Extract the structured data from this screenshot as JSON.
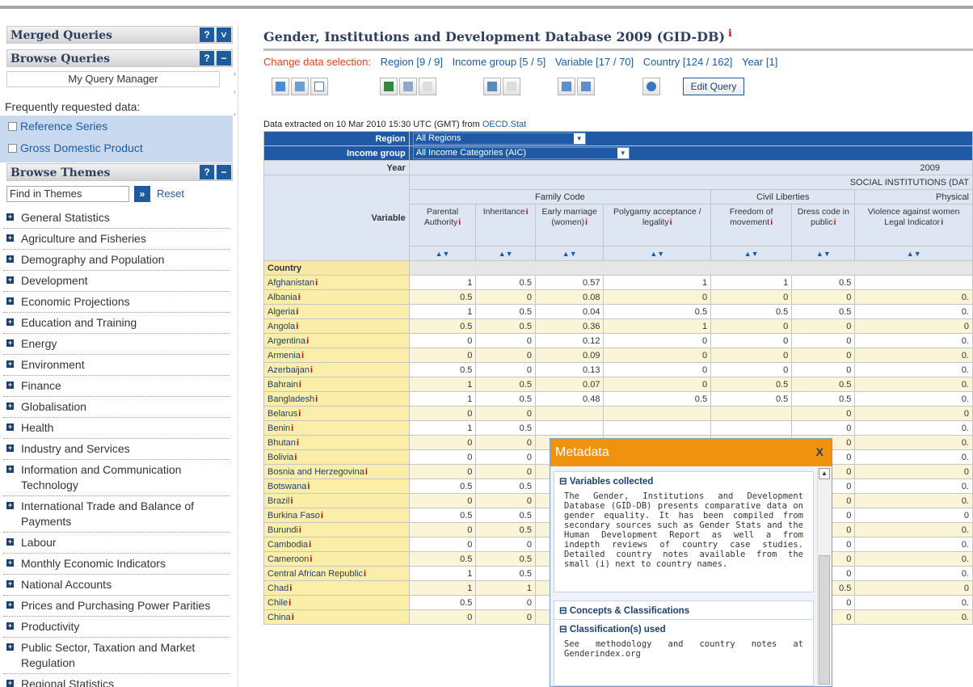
{
  "sidebar": {
    "merged_queries": "Merged Queries",
    "browse_queries": "Browse Queries",
    "help": "?",
    "expand": "˅",
    "collapse": "−",
    "my_query_manager": "My Query Manager",
    "frequently_requested": "Frequently requested data:",
    "freq_items": [
      "Reference Series",
      "Gross Domestic Product"
    ],
    "browse_themes": "Browse Themes",
    "find_placeholder": "Find in Themes",
    "find_go": "»",
    "reset": "Reset",
    "themes": [
      "General Statistics",
      "Agriculture and Fisheries",
      "Demography and Population",
      "Development",
      "Economic Projections",
      "Education and Training",
      "Energy",
      "Environment",
      "Finance",
      "Globalisation",
      "Health",
      "Industry and Services",
      "Information and Communication Technology",
      "International Trade and Balance of Payments",
      "Labour",
      "Monthly Economic Indicators",
      "National Accounts",
      "Prices and Purchasing Power Parities",
      "Productivity",
      "Public Sector, Taxation and Market Regulation",
      "Regional Statistics"
    ]
  },
  "main": {
    "title": "Gender, Institutions and Development Database 2009 (GID-DB)",
    "title_info": "i",
    "change_label": "Change data selection:",
    "selection_links": [
      "Region [9 / 9]",
      "Income group [5 / 5]",
      "Variable [17 / 70]",
      "Country [124 / 162]",
      "Year [1]"
    ],
    "edit_query": "Edit Query",
    "extracted_prefix": "Data extracted on 10 Mar 2010 15:30 UTC (GMT) from ",
    "extracted_source": "OECD.Stat"
  },
  "table": {
    "region_label": "Region",
    "region_value": "All Regions",
    "income_label": "Income group",
    "income_value": "All Income Categories (AIC)",
    "year_label": "Year",
    "year_value": "2009",
    "variable_label": "Variable",
    "group_header": "SOCIAL INSTITUTIONS (DAT",
    "subgroups": [
      "Family Code",
      "Civil Liberties",
      "Physical"
    ],
    "columns": [
      "Parental Authority",
      "Inheritance",
      "Early marriage (women)",
      "Polygamy acceptance / legality",
      "Freedom of movement",
      "Dress code in public",
      "Violence against women Legal Indicator"
    ],
    "sort_glyph": "▲▼",
    "country_label": "Country",
    "info_glyph": "i",
    "rows": [
      {
        "country": "Afghanistan",
        "v": [
          "1",
          "0.5",
          "0.57",
          "1",
          "1",
          "0.5",
          ""
        ]
      },
      {
        "country": "Albania",
        "v": [
          "0.5",
          "0",
          "0.08",
          "0",
          "0",
          "0",
          "0."
        ]
      },
      {
        "country": "Algeria",
        "v": [
          "1",
          "0.5",
          "0.04",
          "0.5",
          "0.5",
          "0.5",
          "0."
        ]
      },
      {
        "country": "Angola",
        "v": [
          "0.5",
          "0.5",
          "0.36",
          "1",
          "0",
          "0",
          "0"
        ]
      },
      {
        "country": "Argentina",
        "v": [
          "0",
          "0",
          "0.12",
          "0",
          "0",
          "0",
          "0."
        ]
      },
      {
        "country": "Armenia",
        "v": [
          "0",
          "0",
          "0.09",
          "0",
          "0",
          "0",
          "0."
        ]
      },
      {
        "country": "Azerbaijan",
        "v": [
          "0.5",
          "0",
          "0.13",
          "0",
          "0",
          "0",
          "0."
        ]
      },
      {
        "country": "Bahrain",
        "v": [
          "1",
          "0.5",
          "0.07",
          "0",
          "0.5",
          "0.5",
          "0."
        ]
      },
      {
        "country": "Bangladesh",
        "v": [
          "1",
          "0.5",
          "0.48",
          "0.5",
          "0.5",
          "0.5",
          "0."
        ]
      },
      {
        "country": "Belarus",
        "v": [
          "0",
          "0",
          "",
          "",
          "",
          "0",
          "0"
        ]
      },
      {
        "country": "Benin",
        "v": [
          "1",
          "0.5",
          "",
          "",
          "",
          "0",
          "0."
        ]
      },
      {
        "country": "Bhutan",
        "v": [
          "0",
          "0",
          "",
          "",
          "",
          "0",
          "0."
        ]
      },
      {
        "country": "Bolivia",
        "v": [
          "0",
          "0",
          "",
          "",
          "",
          "0",
          "0."
        ]
      },
      {
        "country": "Bosnia and Herzegovina",
        "v": [
          "0",
          "0",
          "",
          "",
          "",
          "0",
          "0"
        ]
      },
      {
        "country": "Botswana",
        "v": [
          "0.5",
          "0.5",
          "",
          "",
          "",
          "0",
          "0."
        ]
      },
      {
        "country": "Brazil",
        "v": [
          "0",
          "0",
          "",
          "",
          "",
          "0",
          "0."
        ]
      },
      {
        "country": "Burkina Faso",
        "v": [
          "0.5",
          "0.5",
          "",
          "",
          "",
          "0",
          "0"
        ]
      },
      {
        "country": "Burundi",
        "v": [
          "0",
          "0.5",
          "",
          "",
          "",
          "0",
          "0."
        ]
      },
      {
        "country": "Cambodia",
        "v": [
          "0",
          "0",
          "",
          "",
          "",
          "0",
          "0."
        ]
      },
      {
        "country": "Cameroon",
        "v": [
          "0.5",
          "0.5",
          "",
          "",
          "",
          "0",
          "0."
        ]
      },
      {
        "country": "Central African Republic",
        "v": [
          "1",
          "0.5",
          "",
          "",
          "",
          "0",
          "0."
        ]
      },
      {
        "country": "Chad",
        "v": [
          "1",
          "1",
          "",
          "",
          "",
          "0.5",
          "0"
        ]
      },
      {
        "country": "Chile",
        "v": [
          "0.5",
          "0",
          "",
          "",
          "",
          "0",
          "0."
        ]
      },
      {
        "country": "China",
        "v": [
          "0",
          "0",
          "",
          "",
          "",
          "0",
          "0."
        ]
      }
    ]
  },
  "metadata": {
    "title": "Metadata",
    "close": "X",
    "sec1_title": "Variables collected",
    "sec1_text": "The Gender, Institutions and Development Database (GID-DB) presents comparative data on gender equality. It has been compiled from secondary sources such as Gender Stats and the Human Development Report as well a from indepth reviews of country case studies. Detailed country notes available from the small (i) next to country names.",
    "sec2_title": "Concepts & Classifications",
    "sec3_title": "Classification(s) used",
    "sec3_text": "See methodology and country notes at Genderindex.org",
    "collapse_glyph": "⊟",
    "scroll_up": "▲"
  }
}
